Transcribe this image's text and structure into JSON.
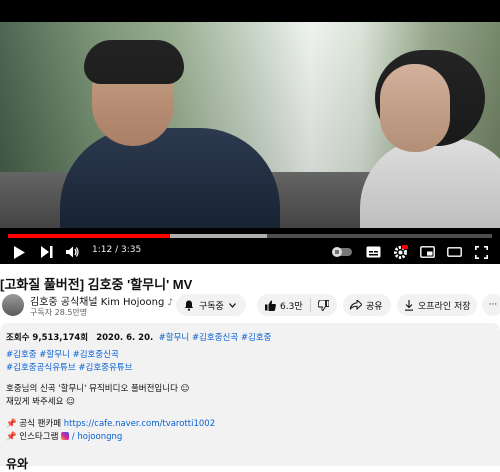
{
  "player": {
    "time_current": "1:12",
    "time_sep": " / ",
    "time_total": "3:35",
    "played_fraction": 0.335,
    "buffer_fraction": 0.2
  },
  "video": {
    "title": "[고화질 풀버전] 김호중 '할무니' MV"
  },
  "channel": {
    "name": "김호중 공식채널 Kim Hojoong",
    "note": "♪",
    "subscribers": "구독자 28.5만명"
  },
  "actions": {
    "subscribe_label": "구독중",
    "likes": "6.3만",
    "share_label": "공유",
    "offline_label": "오프라인 저장",
    "more_label": "···"
  },
  "description": {
    "views": "조회수 9,513,174회",
    "date": "2020. 6. 20.",
    "hashtags_inline": [
      "#할무니",
      "#김호중신곡",
      "#김호중"
    ],
    "hashtags_line2": [
      "#김호중",
      "#할무니",
      "#김호중신곡"
    ],
    "hashtags_line3": [
      "#김호중공식유튜브",
      "#김호중유튜브"
    ],
    "body_line1": "호중님의 신곡 '할무니' 뮤직비디오 풀버전입니다 ☺",
    "body_line2": "재밌게 봐주세요 ☺",
    "fan_cafe_label": "📌 공식 팬카페",
    "fan_cafe_url": "https://cafe.naver.com/tvarotti1002",
    "instagram_label": "📌 인스타그램",
    "instagram_handle": "/ hojoongng",
    "more_text": "유와"
  },
  "colors": {
    "accent": "#ff0000",
    "link": "#065fd4",
    "pill_bg": "#f2f2f2"
  }
}
